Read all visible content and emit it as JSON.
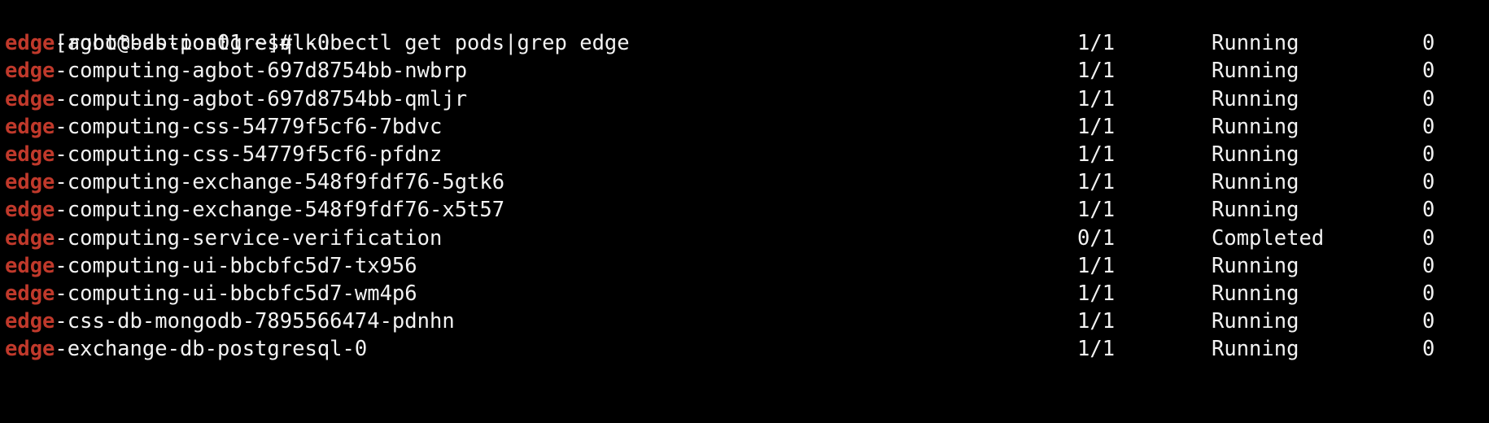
{
  "terminal": {
    "background_color": "#000000",
    "foreground_color": "#f2f2f2",
    "match_highlight_color": "#c0392b",
    "prompt": "[root@bastion01 ~]# ",
    "command": "kubectl get pods|grep edge",
    "prompt_line": "[root@bastion01 ~]# kubectl get pods|grep edge",
    "grep_pattern": "edge"
  },
  "output": {
    "rows": [
      {
        "match": "edge",
        "name_rest": "-agbot-db-postgresql-0",
        "full_name": "edge-agbot-db-postgresql-0",
        "ready": "1/1",
        "status": "Running",
        "restarts": "0"
      },
      {
        "match": "edge",
        "name_rest": "-computing-agbot-697d8754bb-nwbrp",
        "full_name": "edge-computing-agbot-697d8754bb-nwbrp",
        "ready": "1/1",
        "status": "Running",
        "restarts": "0"
      },
      {
        "match": "edge",
        "name_rest": "-computing-agbot-697d8754bb-qmljr",
        "full_name": "edge-computing-agbot-697d8754bb-qmljr",
        "ready": "1/1",
        "status": "Running",
        "restarts": "0"
      },
      {
        "match": "edge",
        "name_rest": "-computing-css-54779f5cf6-7bdvc",
        "full_name": "edge-computing-css-54779f5cf6-7bdvc",
        "ready": "1/1",
        "status": "Running",
        "restarts": "0"
      },
      {
        "match": "edge",
        "name_rest": "-computing-css-54779f5cf6-pfdnz",
        "full_name": "edge-computing-css-54779f5cf6-pfdnz",
        "ready": "1/1",
        "status": "Running",
        "restarts": "0"
      },
      {
        "match": "edge",
        "name_rest": "-computing-exchange-548f9fdf76-5gtk6",
        "full_name": "edge-computing-exchange-548f9fdf76-5gtk6",
        "ready": "1/1",
        "status": "Running",
        "restarts": "0"
      },
      {
        "match": "edge",
        "name_rest": "-computing-exchange-548f9fdf76-x5t57",
        "full_name": "edge-computing-exchange-548f9fdf76-x5t57",
        "ready": "1/1",
        "status": "Running",
        "restarts": "0"
      },
      {
        "match": "edge",
        "name_rest": "-computing-service-verification",
        "full_name": "edge-computing-service-verification",
        "ready": "0/1",
        "status": "Completed",
        "restarts": "0"
      },
      {
        "match": "edge",
        "name_rest": "-computing-ui-bbcbfc5d7-tx956",
        "full_name": "edge-computing-ui-bbcbfc5d7-tx956",
        "ready": "1/1",
        "status": "Running",
        "restarts": "0"
      },
      {
        "match": "edge",
        "name_rest": "-computing-ui-bbcbfc5d7-wm4p6",
        "full_name": "edge-computing-ui-bbcbfc5d7-wm4p6",
        "ready": "1/1",
        "status": "Running",
        "restarts": "0"
      },
      {
        "match": "edge",
        "name_rest": "-css-db-mongodb-7895566474-pdnhn",
        "full_name": "edge-css-db-mongodb-7895566474-pdnhn",
        "ready": "1/1",
        "status": "Running",
        "restarts": "0"
      },
      {
        "match": "edge",
        "name_rest": "-exchange-db-postgresql-0",
        "full_name": "edge-exchange-db-postgresql-0",
        "ready": "1/1",
        "status": "Running",
        "restarts": "0"
      }
    ]
  }
}
